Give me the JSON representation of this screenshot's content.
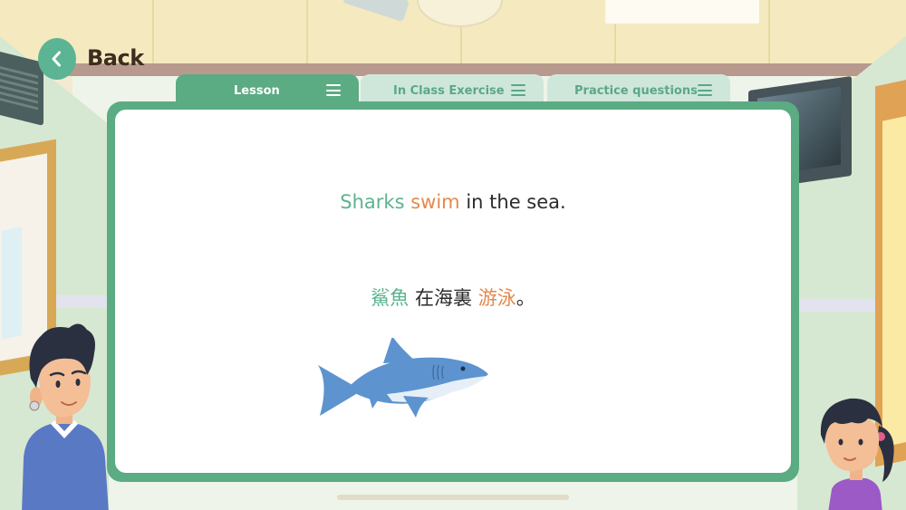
{
  "header": {
    "back_label": "Back"
  },
  "tabs": [
    {
      "label": "Lesson",
      "active": true
    },
    {
      "label": "In Class Exercise",
      "active": false
    },
    {
      "label": "Practice questions",
      "active": false
    }
  ],
  "lesson": {
    "english": {
      "word1": "Sharks",
      "word2": "swim",
      "rest": "in the sea."
    },
    "chinese": {
      "word1": "鯊魚",
      "middle": "在海裏",
      "word2": "游泳",
      "end": "。"
    }
  },
  "colors": {
    "accent_green": "#5bab83",
    "tab_inactive_bg": "#cfe7da",
    "highlight_green": "#5bb38f",
    "highlight_orange": "#e4894d",
    "back_text": "#3c2d20"
  },
  "icons": {
    "back": "chevron-left-icon",
    "tab_menu": "menu-icon",
    "illustration": "shark-icon"
  }
}
